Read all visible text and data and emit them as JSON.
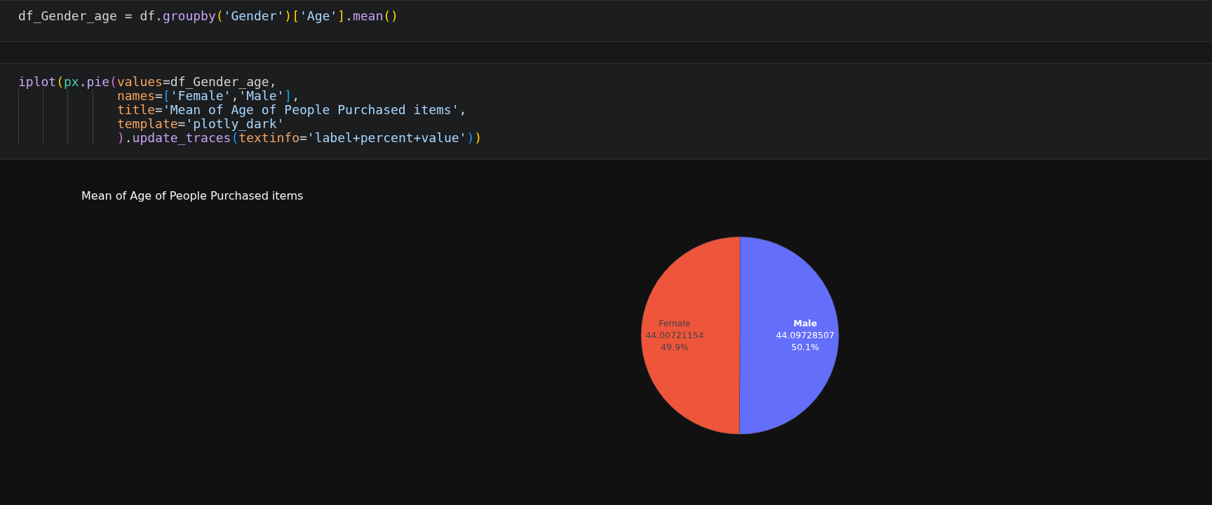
{
  "cells": [
    {
      "lines": [
        {
          "continuation": false,
          "tokens": [
            {
              "text": "df_Gender_age = df.",
              "kind": "plain"
            },
            {
              "text": "groupby",
              "kind": "method"
            },
            {
              "text": "(",
              "kind": "bracket1"
            },
            {
              "text": "'Gender'",
              "kind": "string"
            },
            {
              "text": ")",
              "kind": "bracket1"
            },
            {
              "text": "[",
              "kind": "bracket1"
            },
            {
              "text": "'Age'",
              "kind": "string"
            },
            {
              "text": "]",
              "kind": "bracket1"
            },
            {
              "text": ".",
              "kind": "plain"
            },
            {
              "text": "mean",
              "kind": "method"
            },
            {
              "text": "()",
              "kind": "bracket1"
            }
          ]
        }
      ]
    },
    {
      "lines": [
        {
          "continuation": false,
          "tokens": [
            {
              "text": "iplot",
              "kind": "method"
            },
            {
              "text": "(",
              "kind": "bracket1"
            },
            {
              "text": "px",
              "kind": "module"
            },
            {
              "text": ".",
              "kind": "plain"
            },
            {
              "text": "pie",
              "kind": "method"
            },
            {
              "text": "(",
              "kind": "bracket2"
            },
            {
              "text": "values",
              "kind": "param"
            },
            {
              "text": "=df_Gender_age,",
              "kind": "plain"
            }
          ]
        },
        {
          "continuation": true,
          "tokens": [
            {
              "text": "names",
              "kind": "param"
            },
            {
              "text": "=",
              "kind": "plain"
            },
            {
              "text": "[",
              "kind": "bracket3"
            },
            {
              "text": "'Female'",
              "kind": "string"
            },
            {
              "text": ",",
              "kind": "plain"
            },
            {
              "text": "'Male'",
              "kind": "string"
            },
            {
              "text": "]",
              "kind": "bracket3"
            },
            {
              "text": ",",
              "kind": "plain"
            }
          ]
        },
        {
          "continuation": true,
          "tokens": [
            {
              "text": "title",
              "kind": "param"
            },
            {
              "text": "=",
              "kind": "plain"
            },
            {
              "text": "'Mean of Age of People Purchased items'",
              "kind": "string"
            },
            {
              "text": ",",
              "kind": "plain"
            }
          ]
        },
        {
          "continuation": true,
          "tokens": [
            {
              "text": "template",
              "kind": "param"
            },
            {
              "text": "=",
              "kind": "plain"
            },
            {
              "text": "'plotly_dark'",
              "kind": "string"
            }
          ]
        },
        {
          "continuation": true,
          "tokens": [
            {
              "text": ")",
              "kind": "bracket2"
            },
            {
              "text": ".",
              "kind": "plain"
            },
            {
              "text": "update_traces",
              "kind": "method"
            },
            {
              "text": "(",
              "kind": "bracket3"
            },
            {
              "text": "textinfo",
              "kind": "param"
            },
            {
              "text": "=",
              "kind": "plain"
            },
            {
              "text": "'label+percent+value'",
              "kind": "string"
            },
            {
              "text": ")",
              "kind": "bracket3"
            },
            {
              "text": ")",
              "kind": "bracket1"
            }
          ]
        }
      ]
    }
  ],
  "output": {
    "chart_data": {
      "type": "pie",
      "title": "Mean of Age of People Purchased items",
      "categories": [
        "Female",
        "Male"
      ],
      "values": [
        49.9,
        50.1
      ],
      "colors": [
        "#ef553b",
        "#636efa"
      ],
      "value_labels": [
        [
          "44.00721154",
          "49.9%"
        ],
        [
          "44.09728507",
          "50.1%"
        ]
      ]
    }
  }
}
